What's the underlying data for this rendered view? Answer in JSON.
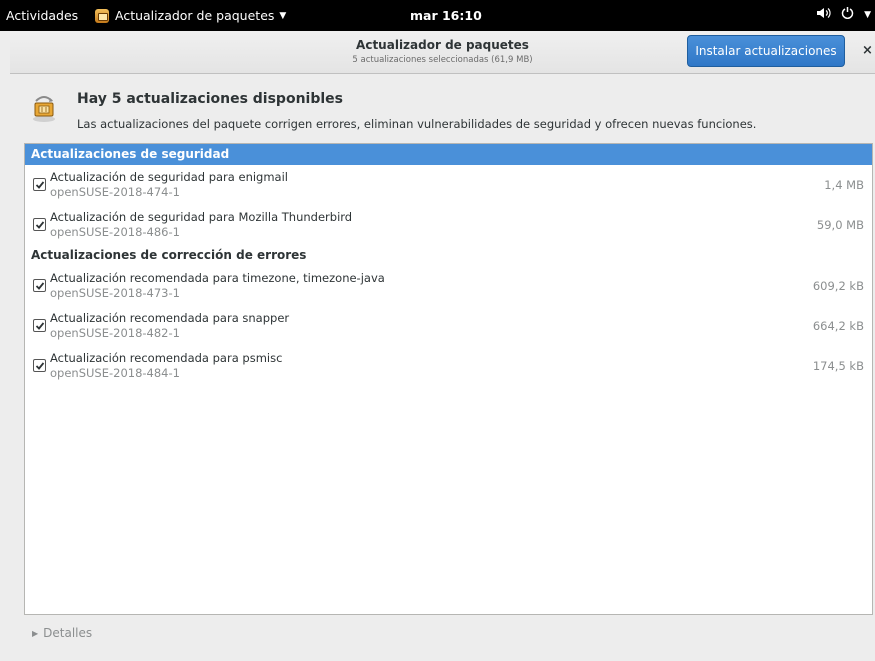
{
  "topbar": {
    "activities": "Actividades",
    "app_menu": "Actualizador de paquetes",
    "clock": "mar 16:10"
  },
  "window": {
    "title": "Actualizador de paquetes",
    "subtitle": "5 actualizaciones seleccionadas (61,9 MB)",
    "install_label": "Instalar actualizaciones",
    "close_label": "×"
  },
  "info": {
    "title": "Hay 5 actualizaciones disponibles",
    "description": "Las actualizaciones del paquete corrigen errores, eliminan vulnerabilidades de seguridad y ofrecen nuevas funciones."
  },
  "sections": [
    {
      "header": "Actualizaciones de seguridad",
      "items": [
        {
          "name": "Actualización de seguridad para enigmail",
          "id": "openSUSE-2018-474-1",
          "size": "1,4 MB",
          "checked": true
        },
        {
          "name": "Actualización de seguridad para Mozilla Thunderbird",
          "id": "openSUSE-2018-486-1",
          "size": "59,0 MB",
          "checked": true
        }
      ]
    },
    {
      "header": "Actualizaciones de corrección de errores",
      "items": [
        {
          "name": "Actualización recomendada para timezone, timezone-java",
          "id": "openSUSE-2018-473-1",
          "size": "609,2 kB",
          "checked": true
        },
        {
          "name": "Actualización recomendada para snapper",
          "id": "openSUSE-2018-482-1",
          "size": "664,2 kB",
          "checked": true
        },
        {
          "name": "Actualización recomendada para psmisc",
          "id": "openSUSE-2018-484-1",
          "size": "174,5 kB",
          "checked": true
        }
      ]
    }
  ],
  "footer": {
    "details_label": "Detalles"
  },
  "icons": {
    "app": "package-updater-icon",
    "volume": "volume-icon",
    "power": "power-icon",
    "expander": "triangle-right-icon"
  },
  "colors": {
    "accent": "#4a90d9",
    "topbar": "#000000"
  }
}
